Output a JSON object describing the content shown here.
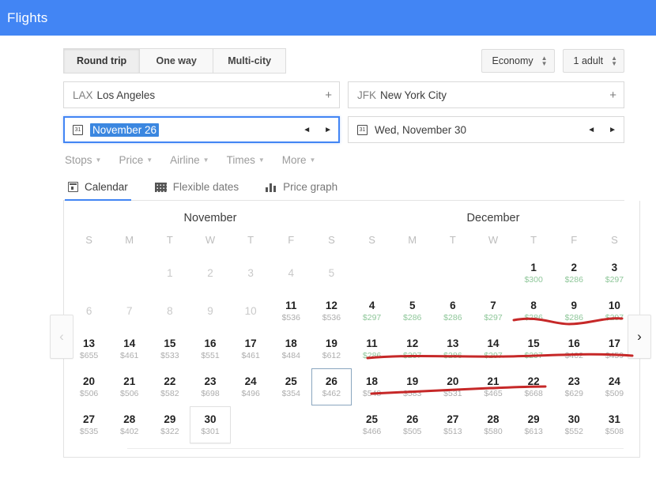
{
  "topbar": {
    "brand": "Flights",
    "color": "#4285f4"
  },
  "trip_types": [
    {
      "label": "Round trip",
      "active": true
    },
    {
      "label": "One way",
      "active": false
    },
    {
      "label": "Multi-city",
      "active": false
    }
  ],
  "pickers": [
    {
      "label": "Economy",
      "name": "cabin-class-picker"
    },
    {
      "label": "1 adult",
      "name": "passenger-picker"
    }
  ],
  "origin": {
    "code": "LAX",
    "city": "Los Angeles",
    "add": "+"
  },
  "destination": {
    "code": "JFK",
    "city": "New York City",
    "add": "+"
  },
  "depart_date": {
    "value": "November 26",
    "selected": true,
    "prev": "◄",
    "next": "►"
  },
  "return_date": {
    "value": "Wed, November 30",
    "prev": "◄",
    "next": "►"
  },
  "filters": [
    {
      "label": "Stops"
    },
    {
      "label": "Price"
    },
    {
      "label": "Airline"
    },
    {
      "label": "Times"
    },
    {
      "label": "More"
    }
  ],
  "tabs": [
    {
      "label": "Calendar",
      "icon": "calendar-icon",
      "active": true
    },
    {
      "label": "Flexible dates",
      "icon": "grid-icon",
      "active": false
    },
    {
      "label": "Price graph",
      "icon": "bar-chart-icon",
      "active": false
    }
  ],
  "calendar_nav": {
    "prev": "‹",
    "next": "›"
  },
  "weekday_labels": [
    "S",
    "M",
    "T",
    "W",
    "T",
    "F",
    "S"
  ],
  "months": [
    {
      "name": "November",
      "lead_blanks": 2,
      "days": [
        {
          "d": "1",
          "p": "",
          "state": "past"
        },
        {
          "d": "2",
          "p": "",
          "state": "past"
        },
        {
          "d": "3",
          "p": "",
          "state": "past"
        },
        {
          "d": "4",
          "p": "",
          "state": "past"
        },
        {
          "d": "5",
          "p": "",
          "state": "past"
        },
        {
          "d": "6",
          "p": "",
          "state": "past"
        },
        {
          "d": "7",
          "p": "",
          "state": "past"
        },
        {
          "d": "8",
          "p": "",
          "state": "past"
        },
        {
          "d": "9",
          "p": "",
          "state": "past"
        },
        {
          "d": "10",
          "p": "",
          "state": "past"
        },
        {
          "d": "11",
          "p": "$536",
          "state": ""
        },
        {
          "d": "12",
          "p": "$536",
          "state": ""
        },
        {
          "d": "13",
          "p": "$655",
          "state": ""
        },
        {
          "d": "14",
          "p": "$461",
          "state": ""
        },
        {
          "d": "15",
          "p": "$533",
          "state": ""
        },
        {
          "d": "16",
          "p": "$551",
          "state": ""
        },
        {
          "d": "17",
          "p": "$461",
          "state": ""
        },
        {
          "d": "18",
          "p": "$484",
          "state": ""
        },
        {
          "d": "19",
          "p": "$612",
          "state": ""
        },
        {
          "d": "20",
          "p": "$506",
          "state": ""
        },
        {
          "d": "21",
          "p": "$506",
          "state": ""
        },
        {
          "d": "22",
          "p": "$582",
          "state": ""
        },
        {
          "d": "23",
          "p": "$698",
          "state": ""
        },
        {
          "d": "24",
          "p": "$496",
          "state": ""
        },
        {
          "d": "25",
          "p": "$354",
          "state": ""
        },
        {
          "d": "26",
          "p": "$462",
          "state": "selected"
        },
        {
          "d": "27",
          "p": "$535",
          "state": ""
        },
        {
          "d": "28",
          "p": "$402",
          "state": ""
        },
        {
          "d": "29",
          "p": "$322",
          "state": ""
        },
        {
          "d": "30",
          "p": "$301",
          "state": "hovered"
        }
      ]
    },
    {
      "name": "December",
      "lead_blanks": 4,
      "days": [
        {
          "d": "1",
          "p": "$300",
          "state": "cheap"
        },
        {
          "d": "2",
          "p": "$286",
          "state": "cheap"
        },
        {
          "d": "3",
          "p": "$297",
          "state": "cheap"
        },
        {
          "d": "4",
          "p": "$297",
          "state": "cheap"
        },
        {
          "d": "5",
          "p": "$286",
          "state": "cheap"
        },
        {
          "d": "6",
          "p": "$286",
          "state": "cheap"
        },
        {
          "d": "7",
          "p": "$297",
          "state": "cheap"
        },
        {
          "d": "8",
          "p": "$286",
          "state": "cheap"
        },
        {
          "d": "9",
          "p": "$286",
          "state": "cheap"
        },
        {
          "d": "10",
          "p": "$297",
          "state": "cheap"
        },
        {
          "d": "11",
          "p": "$286",
          "state": "cheap"
        },
        {
          "d": "12",
          "p": "$297",
          "state": "cheap"
        },
        {
          "d": "13",
          "p": "$286",
          "state": "cheap"
        },
        {
          "d": "14",
          "p": "$297",
          "state": "cheap"
        },
        {
          "d": "15",
          "p": "$297",
          "state": "cheap"
        },
        {
          "d": "16",
          "p": "$402",
          "state": ""
        },
        {
          "d": "17",
          "p": "$459",
          "state": ""
        },
        {
          "d": "18",
          "p": "$548",
          "state": ""
        },
        {
          "d": "19",
          "p": "$583",
          "state": ""
        },
        {
          "d": "20",
          "p": "$531",
          "state": ""
        },
        {
          "d": "21",
          "p": "$465",
          "state": ""
        },
        {
          "d": "22",
          "p": "$668",
          "state": ""
        },
        {
          "d": "23",
          "p": "$629",
          "state": ""
        },
        {
          "d": "24",
          "p": "$509",
          "state": ""
        },
        {
          "d": "25",
          "p": "$466",
          "state": ""
        },
        {
          "d": "26",
          "p": "$505",
          "state": ""
        },
        {
          "d": "27",
          "p": "$513",
          "state": ""
        },
        {
          "d": "28",
          "p": "$580",
          "state": ""
        },
        {
          "d": "29",
          "p": "$613",
          "state": ""
        },
        {
          "d": "30",
          "p": "$552",
          "state": ""
        },
        {
          "d": "31",
          "p": "$508",
          "state": ""
        }
      ]
    }
  ],
  "annotations": {
    "color": "#c62828",
    "strokes": [
      "M650,405 C680,399 700,410 720,410 C745,410 765,401 787,403",
      "M465,453 C520,448 580,452 640,451 C700,450 745,446 800,450",
      "M470,498 C520,496 570,493 620,491 C650,490 670,489 690,489"
    ]
  }
}
